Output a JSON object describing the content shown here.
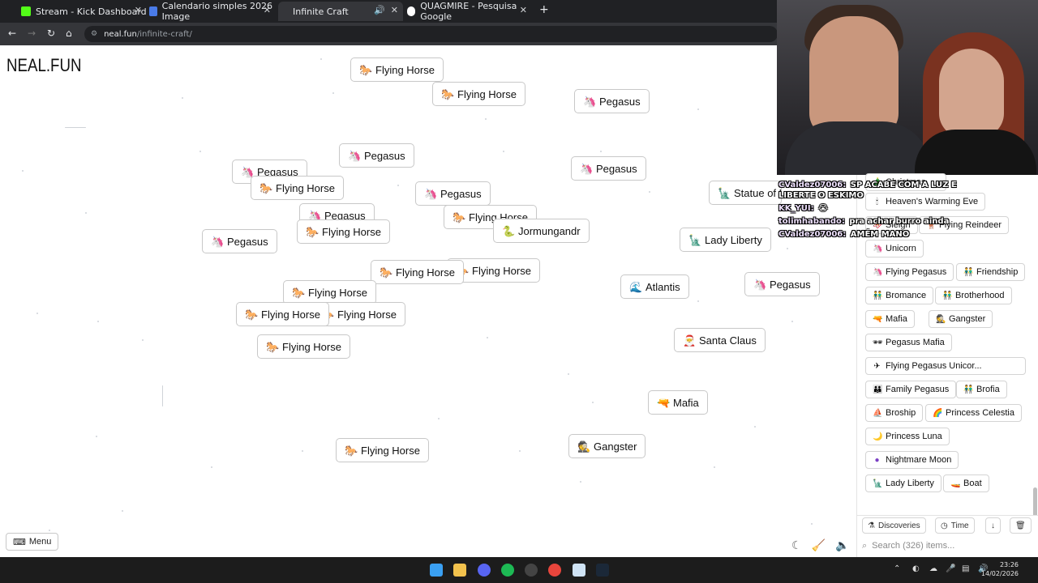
{
  "browser": {
    "tabs": [
      {
        "title": "Stream - Kick Dashboard",
        "favicon_color": "#53fc18"
      },
      {
        "title": "Calendario simples 2026 Image",
        "favicon_color": "#4a7be8"
      },
      {
        "title": "Infinite Craft",
        "favicon_color": "#ffffff"
      },
      {
        "title": "",
        "favicon_color": "#9aa0a6"
      },
      {
        "title": "QUAGMIRE - Pesquisa Google",
        "favicon_color": "#ffffff"
      }
    ],
    "url_host": "neal.fun",
    "url_path": "/infinite-craft/"
  },
  "canvas": {
    "logo": "NEAL.FUN",
    "menu_label": "Menu",
    "items": [
      {
        "label": "Flying Horse",
        "icon": "horse"
      },
      {
        "label": "Flying Horse",
        "icon": "horse"
      },
      {
        "label": "Pegasus",
        "icon": "unicorn"
      },
      {
        "label": "Pegasus",
        "icon": "unicorn"
      },
      {
        "label": "Pegasus",
        "icon": "unicorn"
      },
      {
        "label": "Pegasus",
        "icon": "unicorn"
      },
      {
        "label": "Flying Horse",
        "icon": "horse"
      },
      {
        "label": "Pegasus",
        "icon": "unicorn"
      },
      {
        "label": "Statue of Liberty",
        "icon": "statue"
      },
      {
        "label": "Pegasus",
        "icon": "unicorn"
      },
      {
        "label": "Flying Horse",
        "icon": "horse"
      },
      {
        "label": "Flying Horse",
        "icon": "horse"
      },
      {
        "label": "Jormungandr",
        "icon": "serpent"
      },
      {
        "label": "Pegasus",
        "icon": "unicorn"
      },
      {
        "label": "Lady Liberty",
        "icon": "statue"
      },
      {
        "label": "Flying Horse",
        "icon": "horse"
      },
      {
        "label": "Flying Horse",
        "icon": "horse"
      },
      {
        "label": "Atlantis",
        "icon": "wave"
      },
      {
        "label": "Pegasus",
        "icon": "unicorn"
      },
      {
        "label": "Flying Horse",
        "icon": "horse"
      },
      {
        "label": "Flying Horse",
        "icon": "horse"
      },
      {
        "label": "Flying Horse",
        "icon": "horse"
      },
      {
        "label": "Flying Horse",
        "icon": "horse"
      },
      {
        "label": "Santa Claus",
        "icon": "santa"
      },
      {
        "label": "Mafia",
        "icon": "gun"
      },
      {
        "label": "Flying Horse",
        "icon": "horse"
      },
      {
        "label": "Gangster",
        "icon": "detective"
      }
    ]
  },
  "chat": [
    {
      "user": "CValdez07006:",
      "text": "SP ACABE COM A LUZ E LIBERTE O ESKIMO"
    },
    {
      "user": "KK_YUI:",
      "text": "😭"
    },
    {
      "user": "tolimhabando:",
      "text": "pra achar burro ainda"
    },
    {
      "user": "CValdez07006:",
      "text": "AMÉM MANO"
    }
  ],
  "sidebar": {
    "items": [
      {
        "label": "Christmas",
        "icon": "tree"
      },
      {
        "label": "Heaven's Warming Eve",
        "icon": "candle"
      },
      {
        "label": "Sleigh",
        "icon": "sleigh"
      },
      {
        "label": "Flying Reindeer",
        "icon": "deer"
      },
      {
        "label": "Unicorn",
        "icon": "unicorn"
      },
      {
        "label": "Flying Pegasus",
        "icon": "unicorn"
      },
      {
        "label": "Friendship",
        "icon": "people"
      },
      {
        "label": "Bromance",
        "icon": "people"
      },
      {
        "label": "Brotherhood",
        "icon": "people"
      },
      {
        "label": "Mafia",
        "icon": "gun"
      },
      {
        "label": "Gangster",
        "icon": "detective"
      },
      {
        "label": "Pegasus Mafia",
        "icon": "sunglasses"
      },
      {
        "label": "Flying Pegasus Unicor...",
        "icon": "plane"
      },
      {
        "label": "Family Pegasus",
        "icon": "family"
      },
      {
        "label": "Brofia",
        "icon": "people"
      },
      {
        "label": "Broship",
        "icon": "ship"
      },
      {
        "label": "Princess Celestia",
        "icon": "rainbow"
      },
      {
        "label": "Princess Luna",
        "icon": "moon"
      },
      {
        "label": "Nightmare Moon",
        "icon": "purple-circle"
      },
      {
        "label": "Lady Liberty",
        "icon": "statue"
      },
      {
        "label": "Boat",
        "icon": "boat"
      }
    ],
    "tab_discoveries": "Discoveries",
    "tab_time": "Time",
    "search_placeholder": "Search (326) items..."
  },
  "taskbar": {
    "time": "23:26",
    "date": "14/02/2026"
  }
}
